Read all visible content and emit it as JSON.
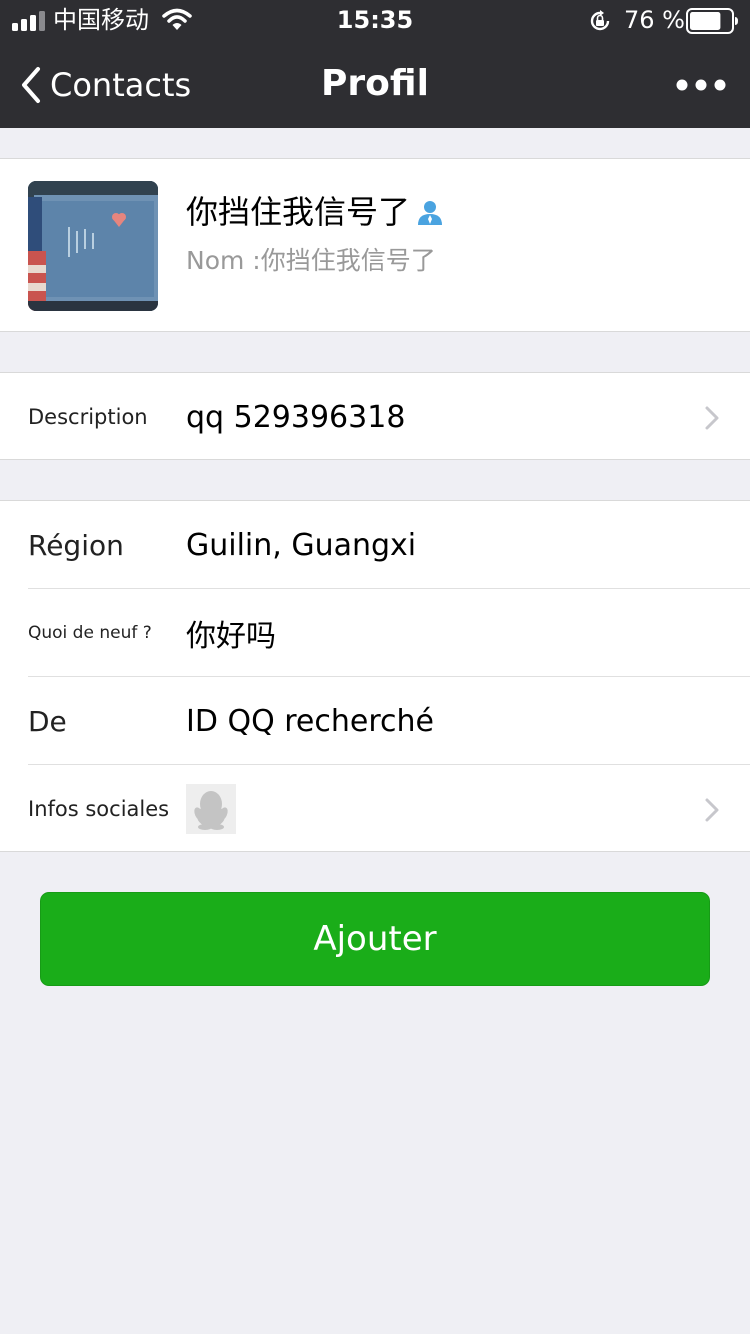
{
  "status_bar": {
    "carrier": "中国移动",
    "time": "15:35",
    "battery_percent": "76 %",
    "battery_level": 0.76
  },
  "nav": {
    "back_label": "Contacts",
    "title": "Profil",
    "more_icon": "more-dots-icon"
  },
  "profile": {
    "display_name": "你挡住我信号了",
    "name_line": "Nom :你挡住我信号了",
    "contact_icon": "person-icon"
  },
  "description": {
    "label": "Description",
    "value": "qq 529396318"
  },
  "info_rows": {
    "region": {
      "label": "Région",
      "value": "Guilin, Guangxi"
    },
    "whats_up": {
      "label": "Quoi de neuf ?",
      "value": "你好吗"
    },
    "from": {
      "label": "De",
      "value": "ID QQ recherché"
    },
    "social": {
      "label": "Infos sociales",
      "icon": "qq-penguin-icon"
    }
  },
  "action": {
    "add_label": "Ajouter"
  },
  "colors": {
    "nav_bg": "#2e2e32",
    "page_bg": "#efeff4",
    "button_green": "#1aad19",
    "contact_icon_blue": "#4aa3e0"
  }
}
